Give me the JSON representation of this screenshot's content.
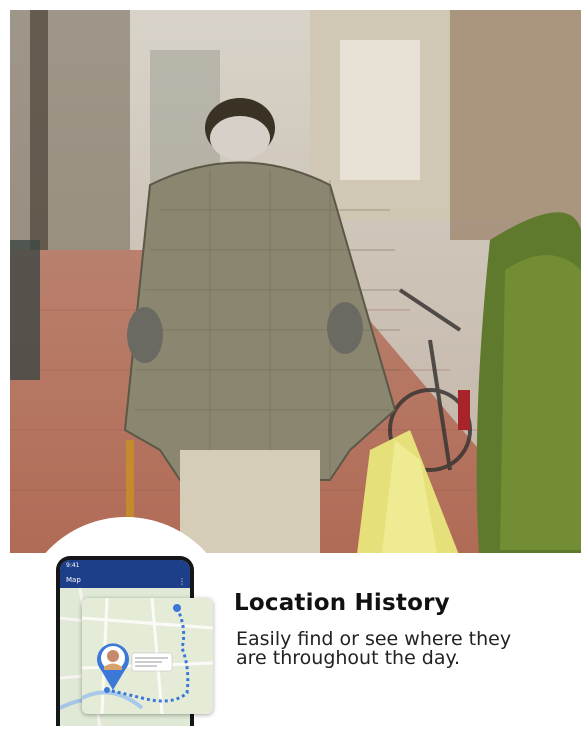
{
  "caption": {
    "title": "Location History",
    "description": "Easily find or see where they are throughout the day."
  },
  "phone": {
    "status_time": "9:41",
    "app_title": "Map"
  },
  "icons": {
    "location_marker": "map-pin-icon",
    "menu": "kebab-menu-icon"
  },
  "colors": {
    "app_bar": "#1d3f8a",
    "route": "#3b78d8",
    "panel": "#ffffff"
  }
}
